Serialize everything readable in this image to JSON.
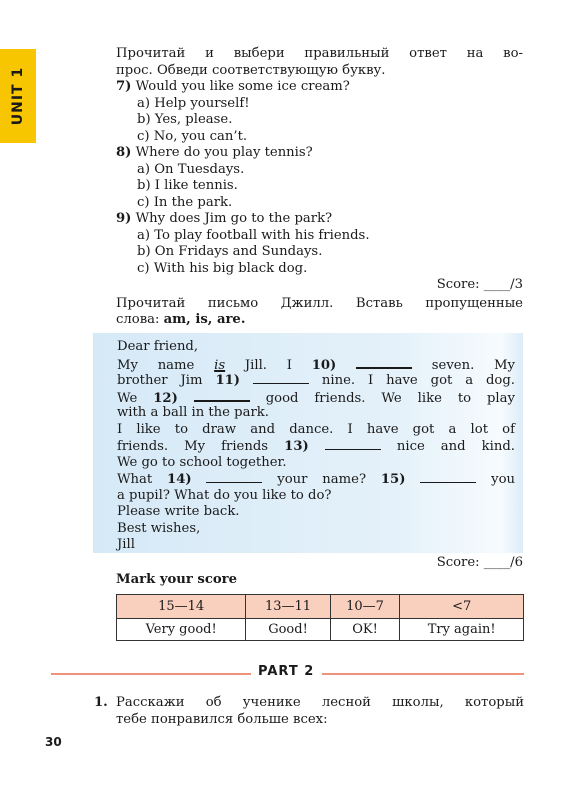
{
  "unit_tab": "UNIT 1",
  "task1": {
    "instruction": [
      "Прочитай и выбери правильный ответ на во-",
      "прос. Обведи соответствующую букву."
    ],
    "questions": [
      {
        "num": "7)",
        "text": "Would you like some ice cream?",
        "options": [
          "a) Help yourself!",
          "b) Yes, please.",
          "c) No, you can’t."
        ]
      },
      {
        "num": "8)",
        "text": "Where do you play tennis?",
        "options": [
          "a) On Tuesdays.",
          "b) I like tennis.",
          "c) In the park."
        ]
      },
      {
        "num": "9)",
        "text": "Why does Jim go to the park?",
        "options": [
          "a) To play football with his friends.",
          "b) On Fridays and Sundays.",
          "c) With his big black dog."
        ]
      }
    ],
    "score": "Score: ____/3"
  },
  "task2": {
    "instruction_line1": "Прочитай письмо Джилл. Вставь пропущенные",
    "instruction_prefix": "слова:",
    "instruction_words": "am, is, are.",
    "letter": {
      "greeting": "Dear friend,",
      "l1a": "My name",
      "l1ans": "is",
      "l1b": "Jill. I",
      "n10": "10)",
      "l1c": "seven. My",
      "l2a": "brother Jim",
      "n11": "11)",
      "l2b": "nine. I have got a dog.",
      "l3a": "We",
      "n12": "12)",
      "l3b": "good friends. We like to play",
      "l4": "with a ball in the park.",
      "l5": "I like to draw and dance. I have got a lot of",
      "l6a": "friends. My friends",
      "n13": "13)",
      "l6b": "nice and kind.",
      "l7": "We go to school together.",
      "l8a": "What",
      "n14": "14)",
      "l8b": "your name?",
      "n15": "15)",
      "l8c": "you",
      "l9": "a pupil? What do you like to do?",
      "l10": "Please write back.",
      "l11": "Best wishes,",
      "l12": "Jill"
    },
    "score": "Score: ____/6"
  },
  "mark": {
    "title": "Mark your score",
    "ranges": [
      "15—14",
      "13—11",
      "10—7",
      "<7"
    ],
    "labels": [
      "Very good!",
      "Good!",
      "OK!",
      "Try again!"
    ],
    "header_color": "#f9cfbe"
  },
  "part": "PART 2",
  "task3": {
    "num": "1.",
    "line1": "Расскажи об ученике лесной школы, который",
    "line2": "тебе понравился больше всех:"
  },
  "page_number": "30",
  "colors": {
    "unit_tab": "#f7c600",
    "part_line": "#f0937b",
    "letter_bg": "#d6e9f7"
  }
}
